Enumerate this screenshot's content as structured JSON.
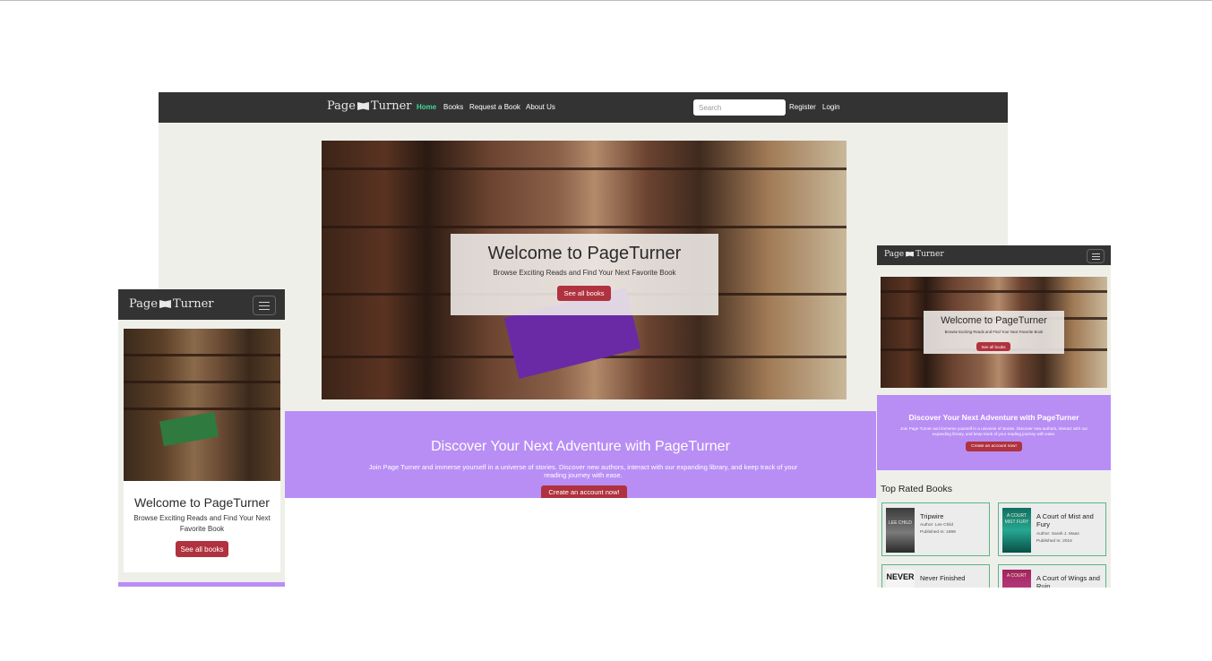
{
  "brand": {
    "word1": "Page",
    "word2": "Turner"
  },
  "nav": {
    "links": [
      "Home",
      "Books",
      "Request a Book",
      "About Us"
    ],
    "search_placeholder": "Search",
    "register": "Register",
    "login": "Login"
  },
  "hero": {
    "title": "Welcome to PageTurner",
    "subtitle": "Browse Exciting Reads and Find Your Next Favorite Book",
    "button": "See all books"
  },
  "cta": {
    "title": "Discover Your Next Adventure with PageTurner",
    "body": "Join Page Turner and immerse yourself in a universe of stories. Discover new authors, interact with our expanding library, and keep track of your reading journey with ease.",
    "button": "Create an account now!"
  },
  "top_rated": {
    "heading": "Top Rated Books",
    "books": [
      {
        "title": "Tripwire",
        "author": "Author: Lee Child",
        "published": "Published In: 1999",
        "cover_text": "LEE CHILD"
      },
      {
        "title": "A Court of Mist and Fury",
        "author": "Author: Sarah J. Maas",
        "published": "Published In: 2016",
        "cover_text": "A COURT MIST FURY"
      },
      {
        "title": "Never Finished",
        "cover_text": "NEVER"
      },
      {
        "title": "A Court of Wings and Ruin",
        "cover_text": "A COURT"
      }
    ]
  },
  "colors": {
    "navbar": "#333333",
    "page_bg": "#efefea",
    "active_link": "#42d79a",
    "accent_button": "#b0323e",
    "cta_band": "#b88ef5",
    "card_border": "#58b48c"
  }
}
